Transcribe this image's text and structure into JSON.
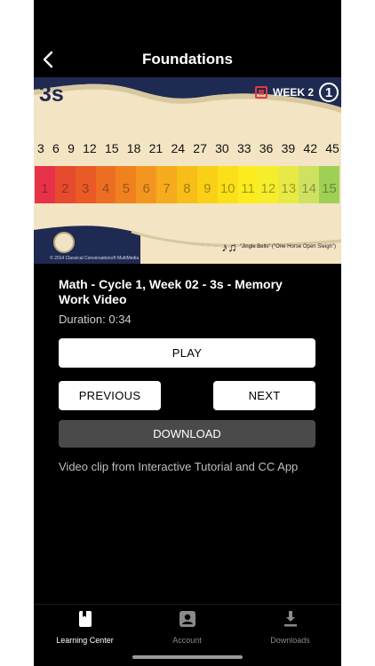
{
  "header": {
    "title": "Foundations"
  },
  "video": {
    "subject": "3s",
    "week_label": "WEEK 2",
    "cycle_badge": "1",
    "multiples": [
      "3",
      "6",
      "9",
      "12",
      "15",
      "18",
      "21",
      "24",
      "27",
      "30",
      "33",
      "36",
      "39",
      "42",
      "45"
    ],
    "counts": [
      "1",
      "2",
      "3",
      "4",
      "5",
      "6",
      "7",
      "8",
      "9",
      "10",
      "11",
      "12",
      "13",
      "14",
      "15"
    ],
    "count_colors": [
      "#e8324a",
      "#e64b2e",
      "#ea5a26",
      "#ed6e22",
      "#f0811f",
      "#f39620",
      "#f6ab1c",
      "#f8bd18",
      "#fad017",
      "#fbe019",
      "#fceb1f",
      "#f6ee2c",
      "#e7ea44",
      "#cfe160",
      "#9fcf55"
    ],
    "copyright": "© 2014 Classical Conversations® MultiMedia",
    "song": "\"Jingle Bells\" (\"One Horse Open Sleigh\")"
  },
  "item": {
    "title": "Math - Cycle 1, Week 02 - 3s  - Memory Work Video",
    "duration": "Duration: 0:34",
    "description": "Video clip from Interactive Tutorial and CC App"
  },
  "buttons": {
    "play": "PLAY",
    "previous": "PREVIOUS",
    "next": "NEXT",
    "download": "DOWNLOAD"
  },
  "tabs": [
    {
      "label": "Learning Center",
      "icon": "book-icon",
      "active": true
    },
    {
      "label": "Account",
      "icon": "account-icon",
      "active": false
    },
    {
      "label": "Downloads",
      "icon": "download-icon",
      "active": false
    }
  ],
  "colors": {
    "navy": "#1f2a52",
    "cream": "#f3e4c3",
    "active_tab": "#ffffff",
    "inactive_tab": "#8a8a8a"
  }
}
